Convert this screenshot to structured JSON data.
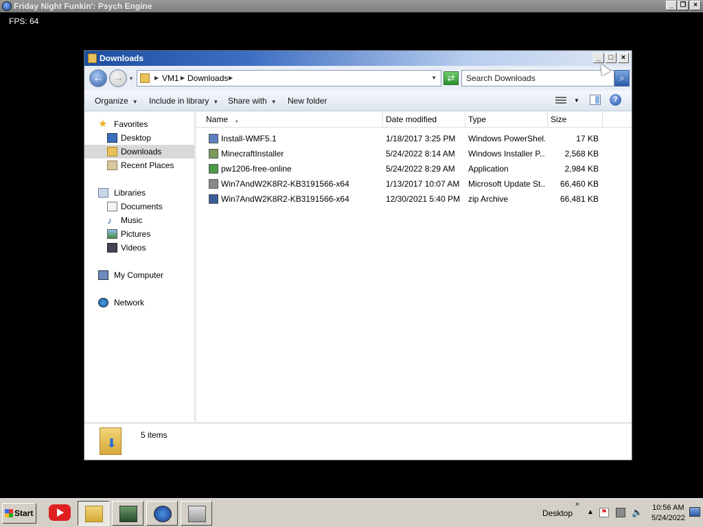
{
  "game_window": {
    "title": "Friday Night Funkin': Psych Engine",
    "fps_text": "FPS: 64"
  },
  "explorer": {
    "title": "Downloads",
    "address": {
      "segments": [
        "VM1",
        "Downloads"
      ]
    },
    "search_placeholder": "Search Downloads",
    "toolbar": {
      "organize": "Organize",
      "include_in_library": "Include in library",
      "share_with": "Share with",
      "new_folder": "New folder"
    },
    "nav": {
      "favorites": "Favorites",
      "desktop": "Desktop",
      "downloads": "Downloads",
      "recent_places": "Recent Places",
      "libraries": "Libraries",
      "documents": "Documents",
      "music": "Music",
      "pictures": "Pictures",
      "videos": "Videos",
      "my_computer": "My Computer",
      "network": "Network"
    },
    "columns": {
      "name": "Name",
      "date_modified": "Date modified",
      "type": "Type",
      "size": "Size"
    },
    "files": [
      {
        "name": "Install-WMF5.1",
        "date": "1/18/2017 3:25 PM",
        "type": "Windows PowerShel...",
        "size": "17 KB",
        "icon": "powershell-script-icon",
        "color": "#5a7fc0"
      },
      {
        "name": "MinecraftInstaller",
        "date": "5/24/2022 8:14 AM",
        "type": "Windows Installer P...",
        "size": "2,568 KB",
        "icon": "installer-package-icon",
        "color": "#7a9a5a"
      },
      {
        "name": "pw1206-free-online",
        "date": "5/24/2022 8:29 AM",
        "type": "Application",
        "size": "2,984 KB",
        "icon": "application-icon",
        "color": "#4a9a4a"
      },
      {
        "name": "Win7AndW2K8R2-KB3191566-x64",
        "date": "1/13/2017 10:07 AM",
        "type": "Microsoft Update St...",
        "size": "66,460 KB",
        "icon": "update-package-icon",
        "color": "#8a8a8a"
      },
      {
        "name": "Win7AndW2K8R2-KB3191566-x64",
        "date": "12/30/2021 5:40 PM",
        "type": "zip Archive",
        "size": "66,481 KB",
        "icon": "zip-archive-icon",
        "color": "#3a5a9a"
      }
    ],
    "status": {
      "items_count": "5 items"
    }
  },
  "taskbar": {
    "start_label": "Start",
    "desktop_label": "Desktop",
    "clock_time": "10:56 AM",
    "clock_date": "5/24/2022"
  }
}
